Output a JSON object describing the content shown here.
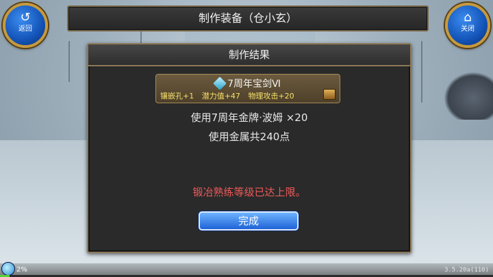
{
  "header": {
    "back_label": "返回",
    "back_icon": "back-arrow-icon",
    "close_label": "关闭",
    "close_icon": "home-icon",
    "title": "制作装备（仓小玄）"
  },
  "result_panel": {
    "heading": "制作结果",
    "item": {
      "name": "7周年宝剑Ⅵ",
      "stats": [
        "镶嵌孔+1",
        "潜力值+47",
        "物理攻击+20"
      ]
    },
    "material_used": "使用7周年金牌·波姆 ×20",
    "metal_used": "使用金属共240点",
    "warning": "锻冶熟练等级已达上限。",
    "done_button": "完成"
  },
  "status": {
    "percent": "2%",
    "progress_fraction": 0.02,
    "version": "3.5.20a(110)"
  },
  "colors": {
    "warning": "#ef5a5a",
    "stat_text": "#f5e06a",
    "button_blue": "#1f63d6"
  }
}
